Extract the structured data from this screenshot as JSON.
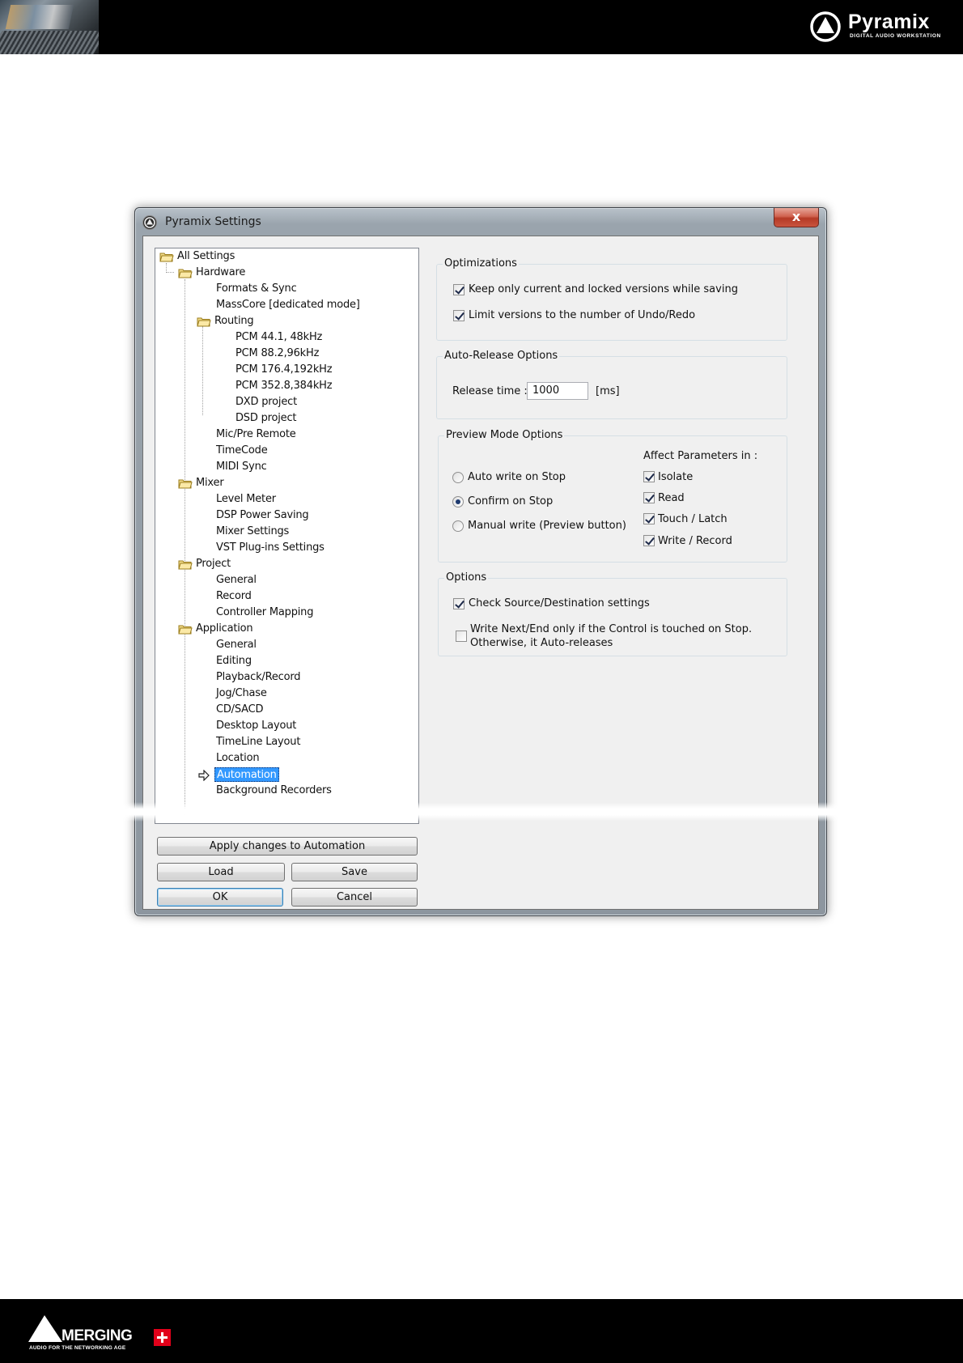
{
  "header": {
    "brand_name": "Pyramix",
    "brand_sub": "DIGITAL AUDIO WORKSTATION"
  },
  "footer": {
    "brand_name": "MERGING",
    "brand_sub": "AUDIO FOR THE NETWORKING AGE"
  },
  "dialog": {
    "title": "Pyramix Settings",
    "close_label": "x",
    "tree": {
      "root": "All Settings",
      "hardware": "Hardware",
      "formats_sync": "Formats & Sync",
      "masscore": "MassCore [dedicated mode]",
      "routing": "Routing",
      "pcm_44": "PCM 44.1, 48kHz",
      "pcm_88": "PCM 88.2,96kHz",
      "pcm_176": "PCM 176.4,192kHz",
      "pcm_352": "PCM 352.8,384kHz",
      "dxd": "DXD project",
      "dsd": "DSD project",
      "mic_pre": "Mic/Pre Remote",
      "timecode": "TimeCode",
      "midi_sync": "MIDI Sync",
      "mixer": "Mixer",
      "level_meter": "Level Meter",
      "dsp_power": "DSP Power Saving",
      "mixer_settings": "Mixer Settings",
      "vst": "VST Plug-ins Settings",
      "project": "Project",
      "project_general": "General",
      "project_record": "Record",
      "controller_mapping": "Controller Mapping",
      "application": "Application",
      "app_general": "General",
      "editing": "Editing",
      "playback_record": "Playback/Record",
      "jog_chase": "Jog/Chase",
      "cd_sacd": "CD/SACD",
      "desktop_layout": "Desktop Layout",
      "timeline_layout": "TimeLine Layout",
      "location": "Location",
      "automation": "Automation",
      "background_recorders": "Background Recorders"
    },
    "buttons": {
      "apply": "Apply changes to Automation",
      "load": "Load",
      "save": "Save",
      "ok": "OK",
      "cancel": "Cancel"
    },
    "optimizations": {
      "label": "Optimizations",
      "keep_versions": "Keep only current and locked versions while saving",
      "keep_versions_checked": true,
      "limit_versions": "Limit versions to the number of Undo/Redo",
      "limit_versions_checked": true
    },
    "auto_release": {
      "label": "Auto-Release Options",
      "release_time_label": "Release time :",
      "release_time_value": "1000",
      "unit": "[ms]"
    },
    "preview_mode": {
      "label": "Preview Mode Options",
      "affect_label": "Affect Parameters in :",
      "radios": [
        "Auto write on Stop",
        "Confirm on Stop",
        "Manual write (Preview button)"
      ],
      "selected_radio": 1,
      "params": [
        "Isolate",
        "Read",
        "Touch / Latch",
        "Write / Record"
      ],
      "params_checked": [
        true,
        true,
        true,
        true
      ]
    },
    "options": {
      "label": "Options",
      "check_source": "Check Source/Destination settings",
      "check_source_checked": true,
      "write_next_line1": "Write Next/End only if the Control is touched on Stop.",
      "write_next_line2": "Otherwise, it Auto-releases",
      "write_next_checked": false
    }
  }
}
